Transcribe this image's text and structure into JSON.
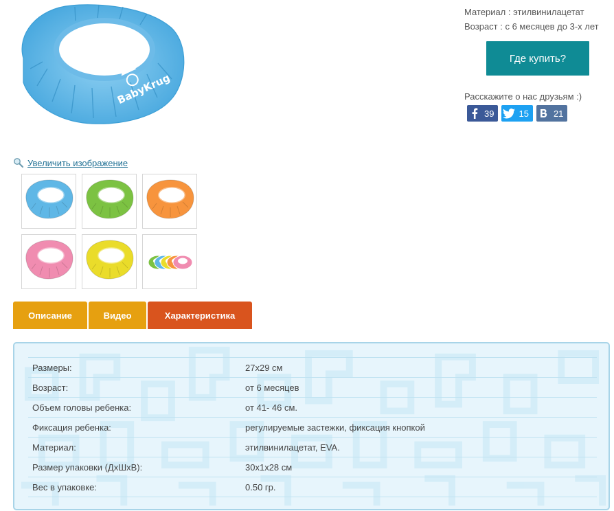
{
  "product": {
    "main_image_alt": "Детский козырек для купания BabyKrug",
    "brand_logo_text": "BabyKrug",
    "zoom_label": "Увеличить изображение"
  },
  "colors": {
    "blue": "#5fb7e6",
    "green": "#7cc242",
    "orange": "#f7943d",
    "pink": "#f08cb0",
    "yellow": "#eadc2a",
    "accent_teal": "#0f8b95",
    "tab_orange": "#e6a010",
    "tab_active": "#d9541e"
  },
  "thumbnails": [
    {
      "color": "blue",
      "icon": "visor-blue-thumb"
    },
    {
      "color": "green",
      "icon": "visor-green-thumb"
    },
    {
      "color": "orange",
      "icon": "visor-orange-thumb"
    },
    {
      "color": "pink",
      "icon": "visor-pink-thumb"
    },
    {
      "color": "yellow",
      "icon": "visor-yellow-thumb"
    },
    {
      "color": "multi",
      "icon": "visor-set-thumb"
    }
  ],
  "info": {
    "material": "Материал : этилвинилацетат",
    "age": "Возраст : с 6 месяцев до 3-х лет",
    "buy_label": "Где купить?",
    "share_text": "Расскажите о нас друзьям :)"
  },
  "shares": {
    "facebook": {
      "icon": "facebook-icon",
      "count": "39"
    },
    "twitter": {
      "icon": "twitter-icon",
      "count": "15"
    },
    "vk": {
      "icon": "vk-icon",
      "count": "21"
    }
  },
  "tabs": [
    {
      "label": "Описание"
    },
    {
      "label": "Видео"
    },
    {
      "label": "Характеристика"
    }
  ],
  "specs": [
    {
      "key": "Размеры:",
      "value": "27x29 см"
    },
    {
      "key": "Возраст:",
      "value": "от 6 месяцев"
    },
    {
      "key": "Объем головы ребенка:",
      "value": "от 41- 46 см."
    },
    {
      "key": "Фиксация ребенка:",
      "value": "регулируемые застежки, фиксация кнопкой"
    },
    {
      "key": "Материал:",
      "value": "этилвинилацетат, EVA."
    },
    {
      "key": "Размер упаковки (ДхШхВ):",
      "value": "30x1x28 см"
    },
    {
      "key": "Вес в упаковке:",
      "value": "0.50 гр."
    }
  ]
}
